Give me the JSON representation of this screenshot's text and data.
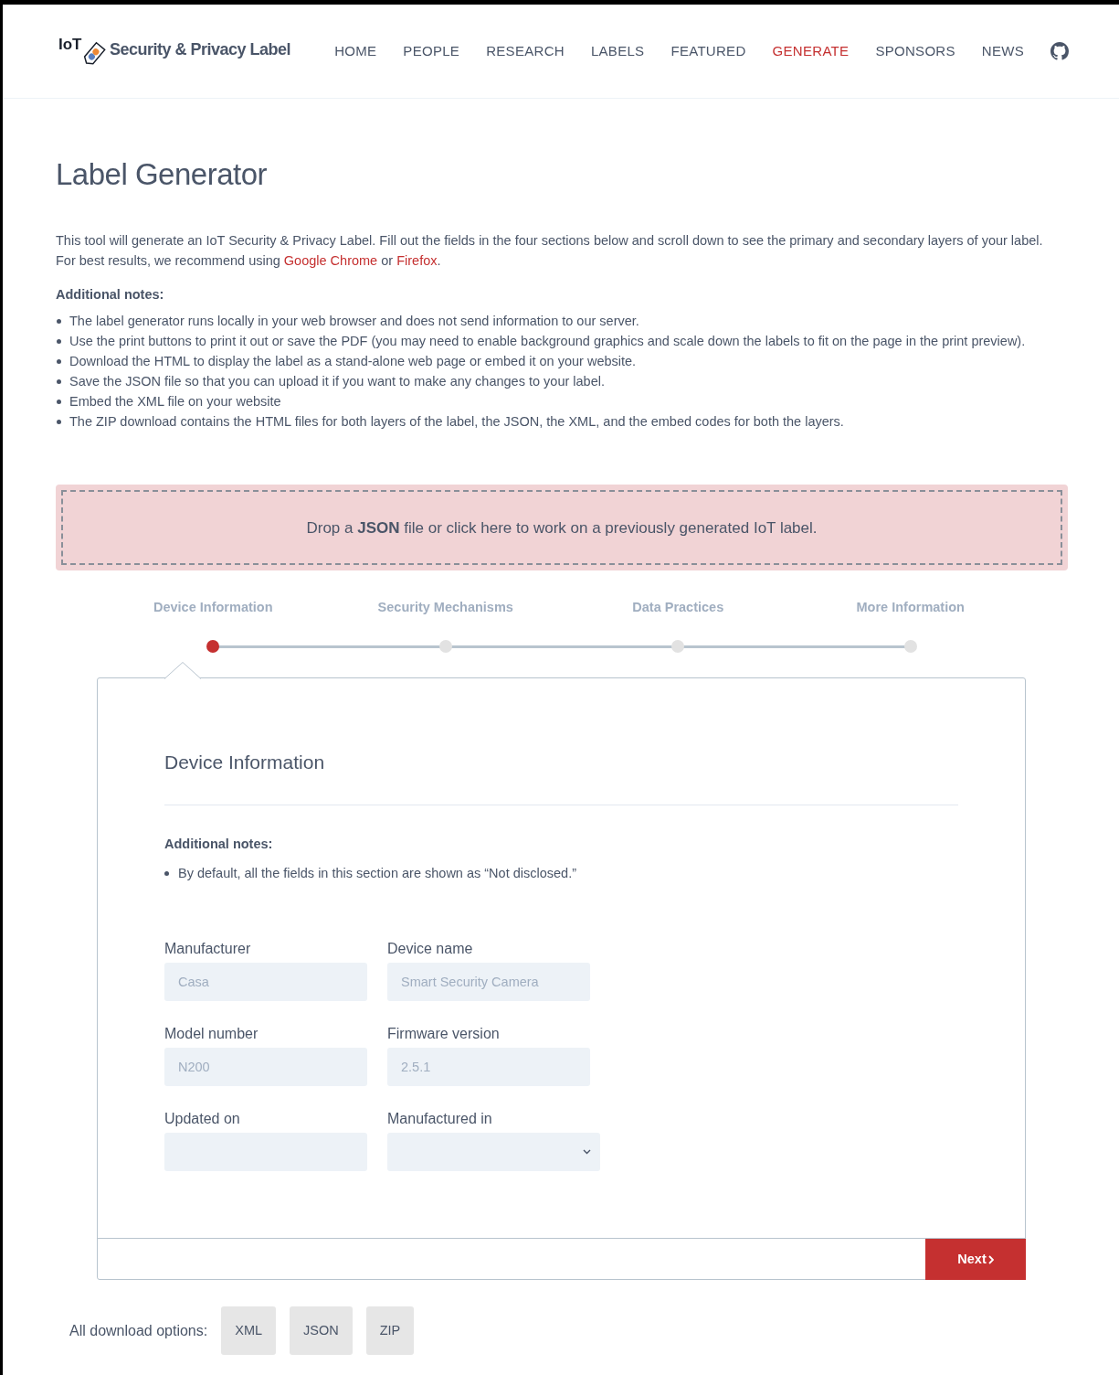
{
  "header": {
    "logo_text": "IoT",
    "site_title": "Security & Privacy Label",
    "nav": [
      {
        "label": "HOME",
        "selected": false
      },
      {
        "label": "PEOPLE",
        "selected": false
      },
      {
        "label": "RESEARCH",
        "selected": false
      },
      {
        "label": "LABELS",
        "selected": false
      },
      {
        "label": "FEATURED",
        "selected": false
      },
      {
        "label": "GENERATE",
        "selected": true
      },
      {
        "label": "SPONSORS",
        "selected": false
      },
      {
        "label": "NEWS",
        "selected": false
      }
    ]
  },
  "title": "Label Generator",
  "intro": "This tool will generate an IoT Security & Privacy Label. Fill out the fields in the four sections below and scroll down to see the primary and secondary layers of your label.",
  "intro2": {
    "before": "For best results, we recommend using",
    "link1": "Google Chrome",
    "middle": "or",
    "link2": "Firefox",
    "after": "."
  },
  "notes_heading": "Additional notes:",
  "notes": [
    "The label generator runs locally in your web browser and does not send information to our server.",
    "Use the print buttons to print it out or save the PDF (you may need to enable background graphics and scale down the labels to fit on the page in the print preview).",
    "Download the HTML to display the label as a stand-alone web page or embed it on your website.",
    "Save the JSON file so that you can upload it if you want to make any changes to your label.",
    "Embed the XML file on your website",
    "The ZIP download contains the HTML files for both layers of the label, the JSON, the XML, and the embed codes for both the layers."
  ],
  "dropzone": "Drop a **JSON** file or click here to work on a previously generated IoT label.",
  "steps": [
    {
      "label": "Device Information",
      "selected": true
    },
    {
      "label": "Security Mechanisms",
      "selected": false
    },
    {
      "label": "Data Practices",
      "selected": false
    },
    {
      "label": "More Information",
      "selected": false
    }
  ],
  "section": {
    "title": "Device Information",
    "notes_heading": "Additional notes:",
    "notes": [
      "By default, all the fields in this section are shown as “Not disclosed.”"
    ],
    "fields": [
      {
        "label": "Manufacturer",
        "kind": "text",
        "placeholder": "Casa"
      },
      {
        "label": "Device name",
        "kind": "text",
        "placeholder": "Smart Security Camera"
      },
      {
        "label": "Model number",
        "kind": "text",
        "placeholder": "N200"
      },
      {
        "label": "Firmware version",
        "kind": "text",
        "placeholder": "2.5.1"
      },
      {
        "label": "Updated on",
        "kind": "text"
      },
      {
        "label": "Manufactured in",
        "kind": "select"
      }
    ],
    "next_button": "Next"
  },
  "downloads": {
    "label": "All download options:",
    "buttons": [
      "XML",
      "JSON",
      "ZIP"
    ]
  }
}
